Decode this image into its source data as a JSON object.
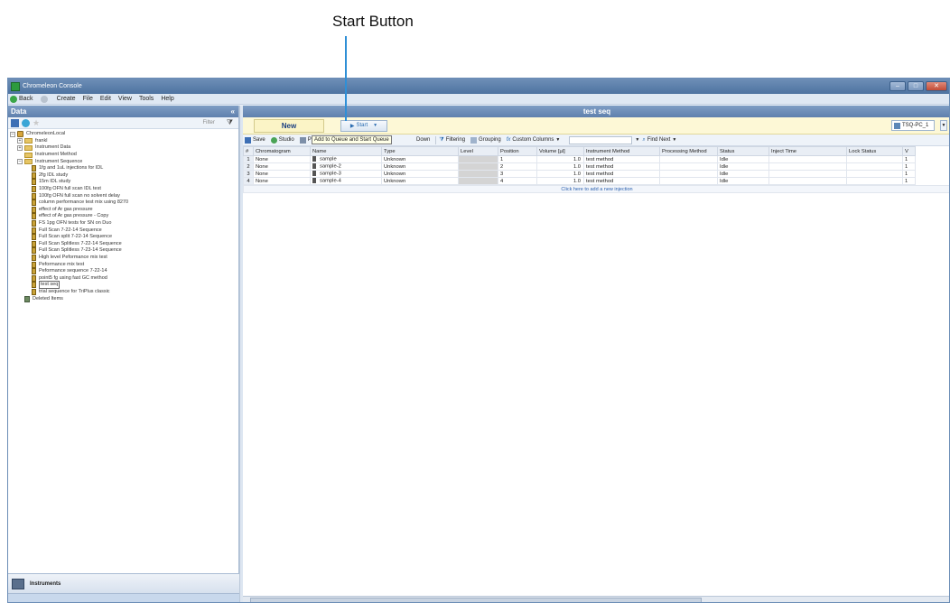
{
  "callout": {
    "label": "Start Button"
  },
  "window": {
    "title": "Chromeleon Console"
  },
  "menubar": {
    "back": "Back",
    "items": [
      "Create",
      "File",
      "Edit",
      "View",
      "Tools",
      "Help"
    ]
  },
  "left_pane": {
    "header": "Data",
    "collapse": "«",
    "filter_label": "Filter",
    "tree": {
      "root": "ChromeleonLocal",
      "folders": [
        "frankl",
        "Instrument Data",
        "Instrument Method",
        "Instrument Sequence"
      ],
      "sequences": [
        "1fg and 1uL injections for IDL",
        "2fg IDL study",
        "15m IDL study",
        "100fg OFN full scan IDL test",
        "100fg OFN full scan no solvent delay",
        "column performance test mix using 8270",
        "effect of Ar gas pressure",
        "effect of Ar gas pressure - Copy",
        "FS 1pg OFN tests for SN on Duo",
        "Full Scan 7-22-14 Sequence",
        "Full Scan split 7-22-14 Sequence",
        "Full Scan Splitless 7-22-14 Sequence",
        "Full Scan Splitless 7-23-14 Sequence",
        "High level Peformance mix test",
        "Peformance mix test",
        "Peformance sequence 7-22-14",
        "point5 fg using fast GC method",
        "test seq",
        "trial sequence for TriPlus classic"
      ],
      "deleted": "Deleted Items"
    },
    "instruments_label": "Instruments"
  },
  "sequence": {
    "title": "test seq",
    "new_label": "New",
    "start_label": "Start",
    "instrument": "TSQ-PC_1",
    "toolbar": {
      "save": "Save",
      "studio": "Studio",
      "print": "Print",
      "tooltip": "Add to Queue and Start Queue",
      "down": "Down",
      "filtering": "Filtering",
      "grouping": "Grouping",
      "custom_columns": "Custom Columns",
      "find_next": "Find Next"
    },
    "columns": [
      "#",
      "Chromatogram",
      "Name",
      "Type",
      "Level",
      "Position",
      "Volume [µl]",
      "Instrument Method",
      "Processing Method",
      "Status",
      "Inject Time",
      "Lock Status",
      "V"
    ],
    "rows": [
      {
        "num": "1",
        "chrom": "None",
        "name": "sample",
        "type": "Unknown",
        "level": "",
        "position": "1",
        "volume": "1.0",
        "method": "test method",
        "processing": "",
        "status": "Idle",
        "inject": "",
        "lock": "",
        "v": "1"
      },
      {
        "num": "2",
        "chrom": "None",
        "name": "sample-2",
        "type": "Unknown",
        "level": "",
        "position": "2",
        "volume": "1.0",
        "method": "test method",
        "processing": "",
        "status": "Idle",
        "inject": "",
        "lock": "",
        "v": "1"
      },
      {
        "num": "3",
        "chrom": "None",
        "name": "sample-3",
        "type": "Unknown",
        "level": "",
        "position": "3",
        "volume": "1.0",
        "method": "test method",
        "processing": "",
        "status": "Idle",
        "inject": "",
        "lock": "",
        "v": "1"
      },
      {
        "num": "4",
        "chrom": "None",
        "name": "sample-4",
        "type": "Unknown",
        "level": "",
        "position": "4",
        "volume": "1.0",
        "method": "test method",
        "processing": "",
        "status": "Idle",
        "inject": "",
        "lock": "",
        "v": "1"
      }
    ],
    "add_injection": "Click here to add a new injection"
  }
}
